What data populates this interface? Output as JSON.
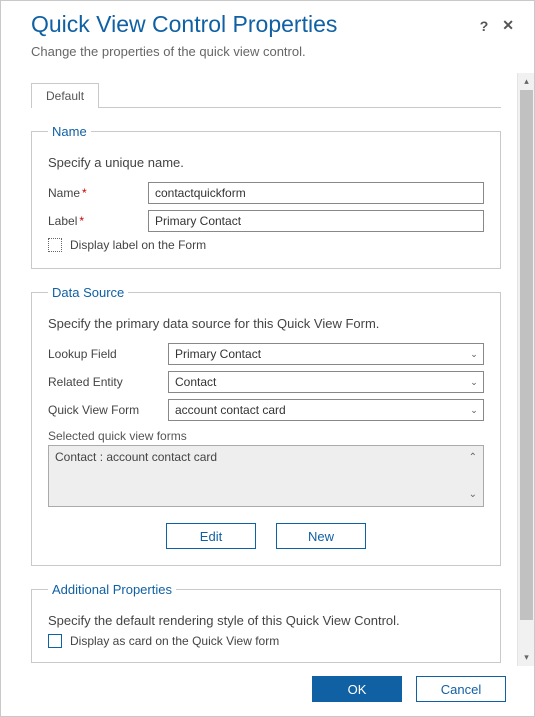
{
  "header": {
    "title": "Quick View Control Properties",
    "subtitle": "Change the properties of the quick view control.",
    "help": "?",
    "close": "✕"
  },
  "tabs": {
    "default": "Default"
  },
  "name_section": {
    "legend": "Name",
    "instr": "Specify a unique name.",
    "name_label": "Name",
    "name_value": "contactquickform",
    "label_label": "Label",
    "label_value": "Primary Contact",
    "display_label_text": "Display label on the Form"
  },
  "data_source": {
    "legend": "Data Source",
    "instr": "Specify the primary data source for this Quick View Form.",
    "lookup_label": "Lookup Field",
    "lookup_value": "Primary Contact",
    "related_label": "Related Entity",
    "related_value": "Contact",
    "qvf_label": "Quick View Form",
    "qvf_value": "account contact card",
    "selected_label": "Selected quick view forms",
    "selected_item": "Contact : account contact card",
    "edit_btn": "Edit",
    "new_btn": "New"
  },
  "additional": {
    "legend": "Additional Properties",
    "instr": "Specify the default rendering style of this Quick View Control.",
    "display_card_text": "Display as card on the Quick View form"
  },
  "footer": {
    "ok": "OK",
    "cancel": "Cancel"
  }
}
